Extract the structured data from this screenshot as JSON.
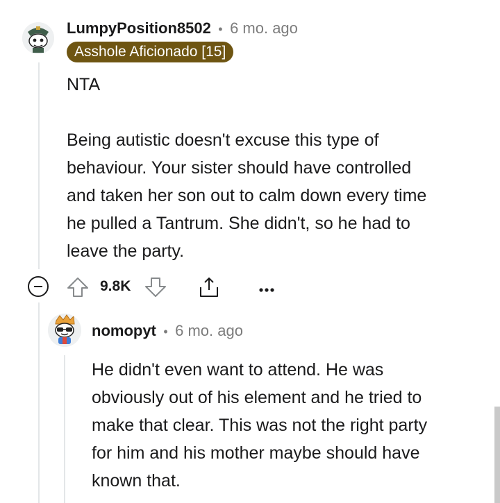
{
  "comment": {
    "username": "LumpyPosition8502",
    "separator": "•",
    "timestamp": "6 mo. ago",
    "flair": "Asshole Aficionado [15]",
    "body": "NTA\n\nBeing autistic doesn't excuse this type of\nbehaviour. Your sister should have controlled\nand taken her son out to calm down every time\nhe pulled a Tantrum. She didn't, so he had to\nleave the party.",
    "score": "9.8K",
    "collapse_icon": "minus-circle-icon",
    "upvote_icon": "upvote-arrow-icon",
    "downvote_icon": "downvote-arrow-icon",
    "share_icon": "share-icon",
    "more_icon": "more-options-icon"
  },
  "reply": {
    "username": "nomopyt",
    "separator": "•",
    "timestamp": "6 mo. ago",
    "body": "He didn't even want to attend. He was\nobviously out of his element and he tried to\nmake that clear. This was not the right party\nfor him and his mother maybe should have\nknown that."
  },
  "colors": {
    "flair_bg": "#6e5512",
    "muted_text": "#7c7c7c",
    "thread_line": "#e3e6e8"
  }
}
